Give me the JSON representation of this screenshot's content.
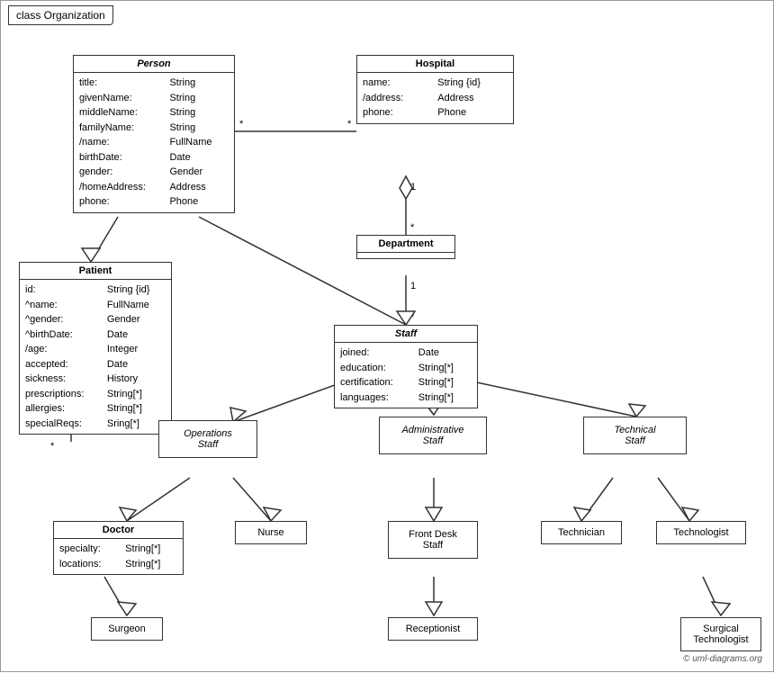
{
  "title": "class Organization",
  "copyright": "© uml-diagrams.org",
  "classes": {
    "person": {
      "name": "Person",
      "italic": true,
      "attrs": [
        [
          "title:",
          "String"
        ],
        [
          "givenName:",
          "String"
        ],
        [
          "middleName:",
          "String"
        ],
        [
          "familyName:",
          "String"
        ],
        [
          "/name:",
          "FullName"
        ],
        [
          "birthDate:",
          "Date"
        ],
        [
          "gender:",
          "Gender"
        ],
        [
          "/homeAddress:",
          "Address"
        ],
        [
          "phone:",
          "Phone"
        ]
      ]
    },
    "hospital": {
      "name": "Hospital",
      "attrs": [
        [
          "name:",
          "String {id}"
        ],
        [
          "/address:",
          "Address"
        ],
        [
          "phone:",
          "Phone"
        ]
      ]
    },
    "patient": {
      "name": "Patient",
      "attrs": [
        [
          "id:",
          "String {id}"
        ],
        [
          "^name:",
          "FullName"
        ],
        [
          "^gender:",
          "Gender"
        ],
        [
          "^birthDate:",
          "Date"
        ],
        [
          "/age:",
          "Integer"
        ],
        [
          "accepted:",
          "Date"
        ],
        [
          "sickness:",
          "History"
        ],
        [
          "prescriptions:",
          "String[*]"
        ],
        [
          "allergies:",
          "String[*]"
        ],
        [
          "specialReqs:",
          "Sring[*]"
        ]
      ]
    },
    "department": {
      "name": "Department"
    },
    "staff": {
      "name": "Staff",
      "italic": true,
      "attrs": [
        [
          "joined:",
          "Date"
        ],
        [
          "education:",
          "String[*]"
        ],
        [
          "certification:",
          "String[*]"
        ],
        [
          "languages:",
          "String[*]"
        ]
      ]
    },
    "operationsStaff": {
      "name": "Operations\nStaff",
      "italic": true
    },
    "administrativeStaff": {
      "name": "Administrative\nStaff",
      "italic": true
    },
    "technicalStaff": {
      "name": "Technical\nStaff",
      "italic": true
    },
    "doctor": {
      "name": "Doctor",
      "attrs": [
        [
          "specialty:",
          "String[*]"
        ],
        [
          "locations:",
          "String[*]"
        ]
      ]
    },
    "nurse": {
      "name": "Nurse"
    },
    "frontDeskStaff": {
      "name": "Front Desk\nStaff"
    },
    "technician": {
      "name": "Technician"
    },
    "technologist": {
      "name": "Technologist"
    },
    "surgeon": {
      "name": "Surgeon"
    },
    "receptionist": {
      "name": "Receptionist"
    },
    "surgicalTechnologist": {
      "name": "Surgical\nTechnologist"
    }
  }
}
